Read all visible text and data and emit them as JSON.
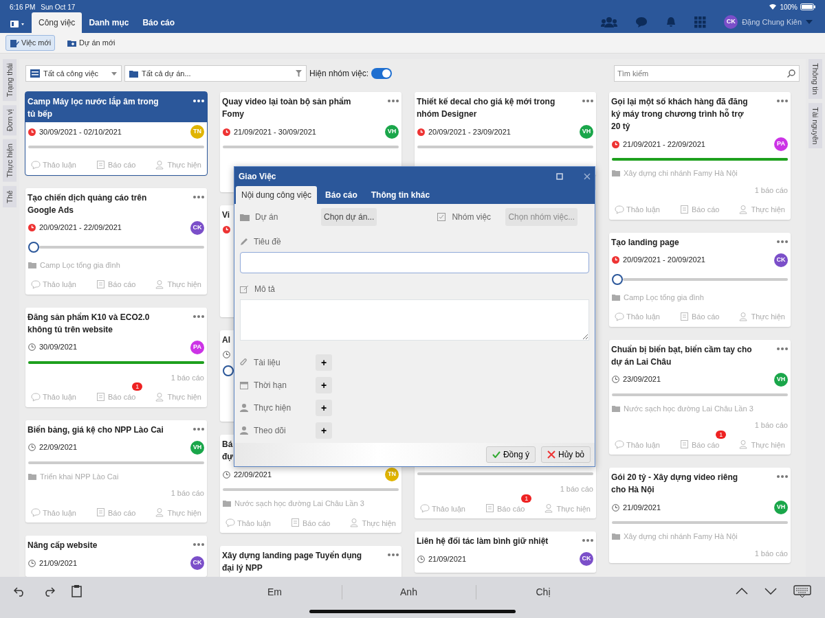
{
  "status_bar": {
    "time": "6:16 PM",
    "date": "Sun Oct 17",
    "battery": "100%"
  },
  "nav": {
    "tabs": [
      {
        "label": "Công việc",
        "selected": true
      },
      {
        "label": "Danh mục",
        "selected": false
      },
      {
        "label": "Báo cáo",
        "selected": false
      }
    ],
    "user": {
      "initials": "CK",
      "name": "Đặng Chung Kiên",
      "color": "#7b4fc9"
    }
  },
  "toolbar": [
    {
      "label": "Việc mới",
      "selected": true
    },
    {
      "label": "Dự án mới",
      "selected": false
    }
  ],
  "left_tabs": [
    "Trạng thái",
    "Đơn vị",
    "Thực hiện",
    "Thẻ"
  ],
  "right_tabs": [
    "Thông tin",
    "Tài nguyên"
  ],
  "filters": {
    "task_select": "Tất cả công việc",
    "project_select": "Tất cả dự án...",
    "group_toggle": {
      "label": "Hiện nhóm việc:",
      "on": true
    },
    "search": {
      "placeholder": "Tìm kiếm"
    }
  },
  "columns": [
    {
      "cards": [
        {
          "title": "Camp Máy lọc nước lắp âm trong tủ bếp",
          "selected": true,
          "overdue": true,
          "date": "30/09/2021 - 02/10/2021",
          "avatar": {
            "initials": "TN",
            "color": "#e0b400"
          },
          "level": 0,
          "actions": [
            "Thảo luận",
            "Báo cáo",
            "Thực hiện"
          ]
        },
        {
          "title": "Tạo chiến dịch quảng cáo trên Google Ads",
          "selected": false,
          "overdue": true,
          "date": "20/09/2021 - 22/09/2021",
          "avatar": {
            "initials": "CK",
            "color": "#7b4fc9"
          },
          "level": 0,
          "thumb": true,
          "project": "Camp Lọc tổng gia đình",
          "actions": [
            "Thảo luận",
            "Báo cáo",
            "Thực hiện"
          ]
        },
        {
          "title": "Đăng sản phẩm K10 và ECO2.0 không tủ trên website",
          "selected": false,
          "overdue": false,
          "date": "30/09/2021",
          "avatar": {
            "initials": "PA",
            "color": "#cc33e6"
          },
          "level": 1,
          "reports": "1 báo cáo",
          "badge": "1",
          "actions": [
            "Thảo luận",
            "Báo cáo",
            "Thực hiện"
          ]
        },
        {
          "title": "Biển bảng, giá kệ cho NPP Lào Cai",
          "selected": false,
          "overdue": false,
          "date": "22/09/2021",
          "avatar": {
            "initials": "VH",
            "color": "#1aa64a"
          },
          "level": 0,
          "project": "Triển khai NPP Lào Cai",
          "reports": "1 báo cáo",
          "actions": [
            "Thảo luận",
            "Báo cáo",
            "Thực hiện"
          ]
        },
        {
          "title": "Nâng cấp website",
          "selected": false,
          "overdue": false,
          "date": "21/09/2021",
          "avatar": {
            "initials": "CK",
            "color": "#7b4fc9"
          }
        }
      ]
    },
    {
      "cards": [
        {
          "title": "Quay video lại toàn bộ sản phẩm Fomy",
          "selected": false,
          "overdue": true,
          "date": "21/09/2021 - 30/09/2021",
          "avatar": {
            "initials": "VH",
            "color": "#1aa64a"
          },
          "level": 0
        },
        {
          "title": "Vi",
          "selected": false,
          "overdue": true
        },
        {
          "title": "Al",
          "selected": false,
          "overdue": false,
          "level": 0,
          "thumb": true
        },
        {
          "title": "Bá\nđự",
          "selected": false,
          "overdue": false,
          "date": "22/09/2021",
          "avatar": {
            "initials": "TN",
            "color": "#e0b400"
          },
          "level": 0,
          "project": "Nước sạch học đường Lai Châu Lần 3",
          "actions": [
            "Thảo luận",
            "Báo cáo",
            "Thực hiện"
          ]
        },
        {
          "title": "Xây dựng landing page Tuyển dụng đại lý NPP",
          "selected": false
        }
      ]
    },
    {
      "cards": [
        {
          "title": "Thiết kế decal cho giá kệ mới trong nhóm Designer",
          "selected": false,
          "overdue": true,
          "date": "20/09/2021 - 23/09/2021",
          "avatar": {
            "initials": "VH",
            "color": "#1aa64a"
          },
          "level": 0
        },
        {
          "selected": false,
          "level": 0,
          "reports": "1 báo cáo",
          "badge": "1",
          "actions": [
            "Thảo luận",
            "Báo cáo",
            "Thực hiện"
          ]
        },
        {
          "title": "Liên hệ đối tác làm bình giữ nhiệt",
          "selected": false,
          "overdue": false,
          "date": "21/09/2021",
          "avatar": {
            "initials": "CK",
            "color": "#7b4fc9"
          }
        }
      ]
    },
    {
      "cards": [
        {
          "title": "Gọi lại một số khách hàng đã đăng ký máy trong chương trình hỗ trợ 20 tỷ",
          "selected": false,
          "overdue": true,
          "date": "21/09/2021 - 22/09/2021",
          "avatar": {
            "initials": "PA",
            "color": "#cc33e6"
          },
          "level": 1,
          "project": "Xây dựng chi nhánh Famy Hà Nội",
          "reports": "1 báo cáo",
          "actions": [
            "Thảo luận",
            "Báo cáo",
            "Thực hiện"
          ]
        },
        {
          "title": "Tạo landing page",
          "selected": false,
          "overdue": true,
          "date": "20/09/2021 - 20/09/2021",
          "avatar": {
            "initials": "CK",
            "color": "#7b4fc9"
          },
          "level": 0,
          "thumb": true,
          "project": "Camp Lọc tổng gia đình",
          "actions": [
            "Thảo luận",
            "Báo cáo",
            "Thực hiện"
          ]
        },
        {
          "title": "Chuẩn bị biển bạt, biển cầm tay cho dự án Lai Châu",
          "selected": false,
          "overdue": false,
          "date": "23/09/2021",
          "avatar": {
            "initials": "VH",
            "color": "#1aa64a"
          },
          "level": 0,
          "project": "Nước sạch học đường Lai Châu Lần 3",
          "reports": "1 báo cáo",
          "badge": "1",
          "actions": [
            "Thảo luận",
            "Báo cáo",
            "Thực hiện"
          ]
        },
        {
          "title": "Gói 20 tỷ - Xây dựng video riêng cho Hà Nội",
          "selected": false,
          "overdue": false,
          "date": "21/09/2021",
          "avatar": {
            "initials": "VH",
            "color": "#1aa64a"
          },
          "level": 0,
          "project": "Xây dựng chi nhánh Famy Hà Nội",
          "reports": "1 báo cáo"
        }
      ]
    }
  ],
  "dialog": {
    "title": "Giao Việc",
    "tabs": [
      {
        "label": "Nội dung công việc",
        "selected": true
      },
      {
        "label": "Báo cáo",
        "selected": false
      },
      {
        "label": "Thông tin khác",
        "selected": false
      }
    ],
    "project": {
      "label": "Dự án",
      "button": "Chọn dự án..."
    },
    "group": {
      "label": "Nhóm việc",
      "button": "Chọn nhóm việc...",
      "disabled": true
    },
    "title_label": "Tiêu đề",
    "description_label": "Mô tả",
    "add_rows": [
      {
        "label": "Tài liệu",
        "button": "+"
      },
      {
        "label": "Thời hạn",
        "button": "+"
      },
      {
        "label": "Thực hiện",
        "button": "+"
      },
      {
        "label": "Theo dõi",
        "button": "+"
      }
    ],
    "buttons": [
      {
        "kind": "ok",
        "label": "Đồng ý"
      },
      {
        "kind": "cancel",
        "label": "Hủy bỏ"
      }
    ]
  },
  "keyboard_bar": {
    "suggestions": [
      "Em",
      "Anh",
      "Chị"
    ]
  }
}
